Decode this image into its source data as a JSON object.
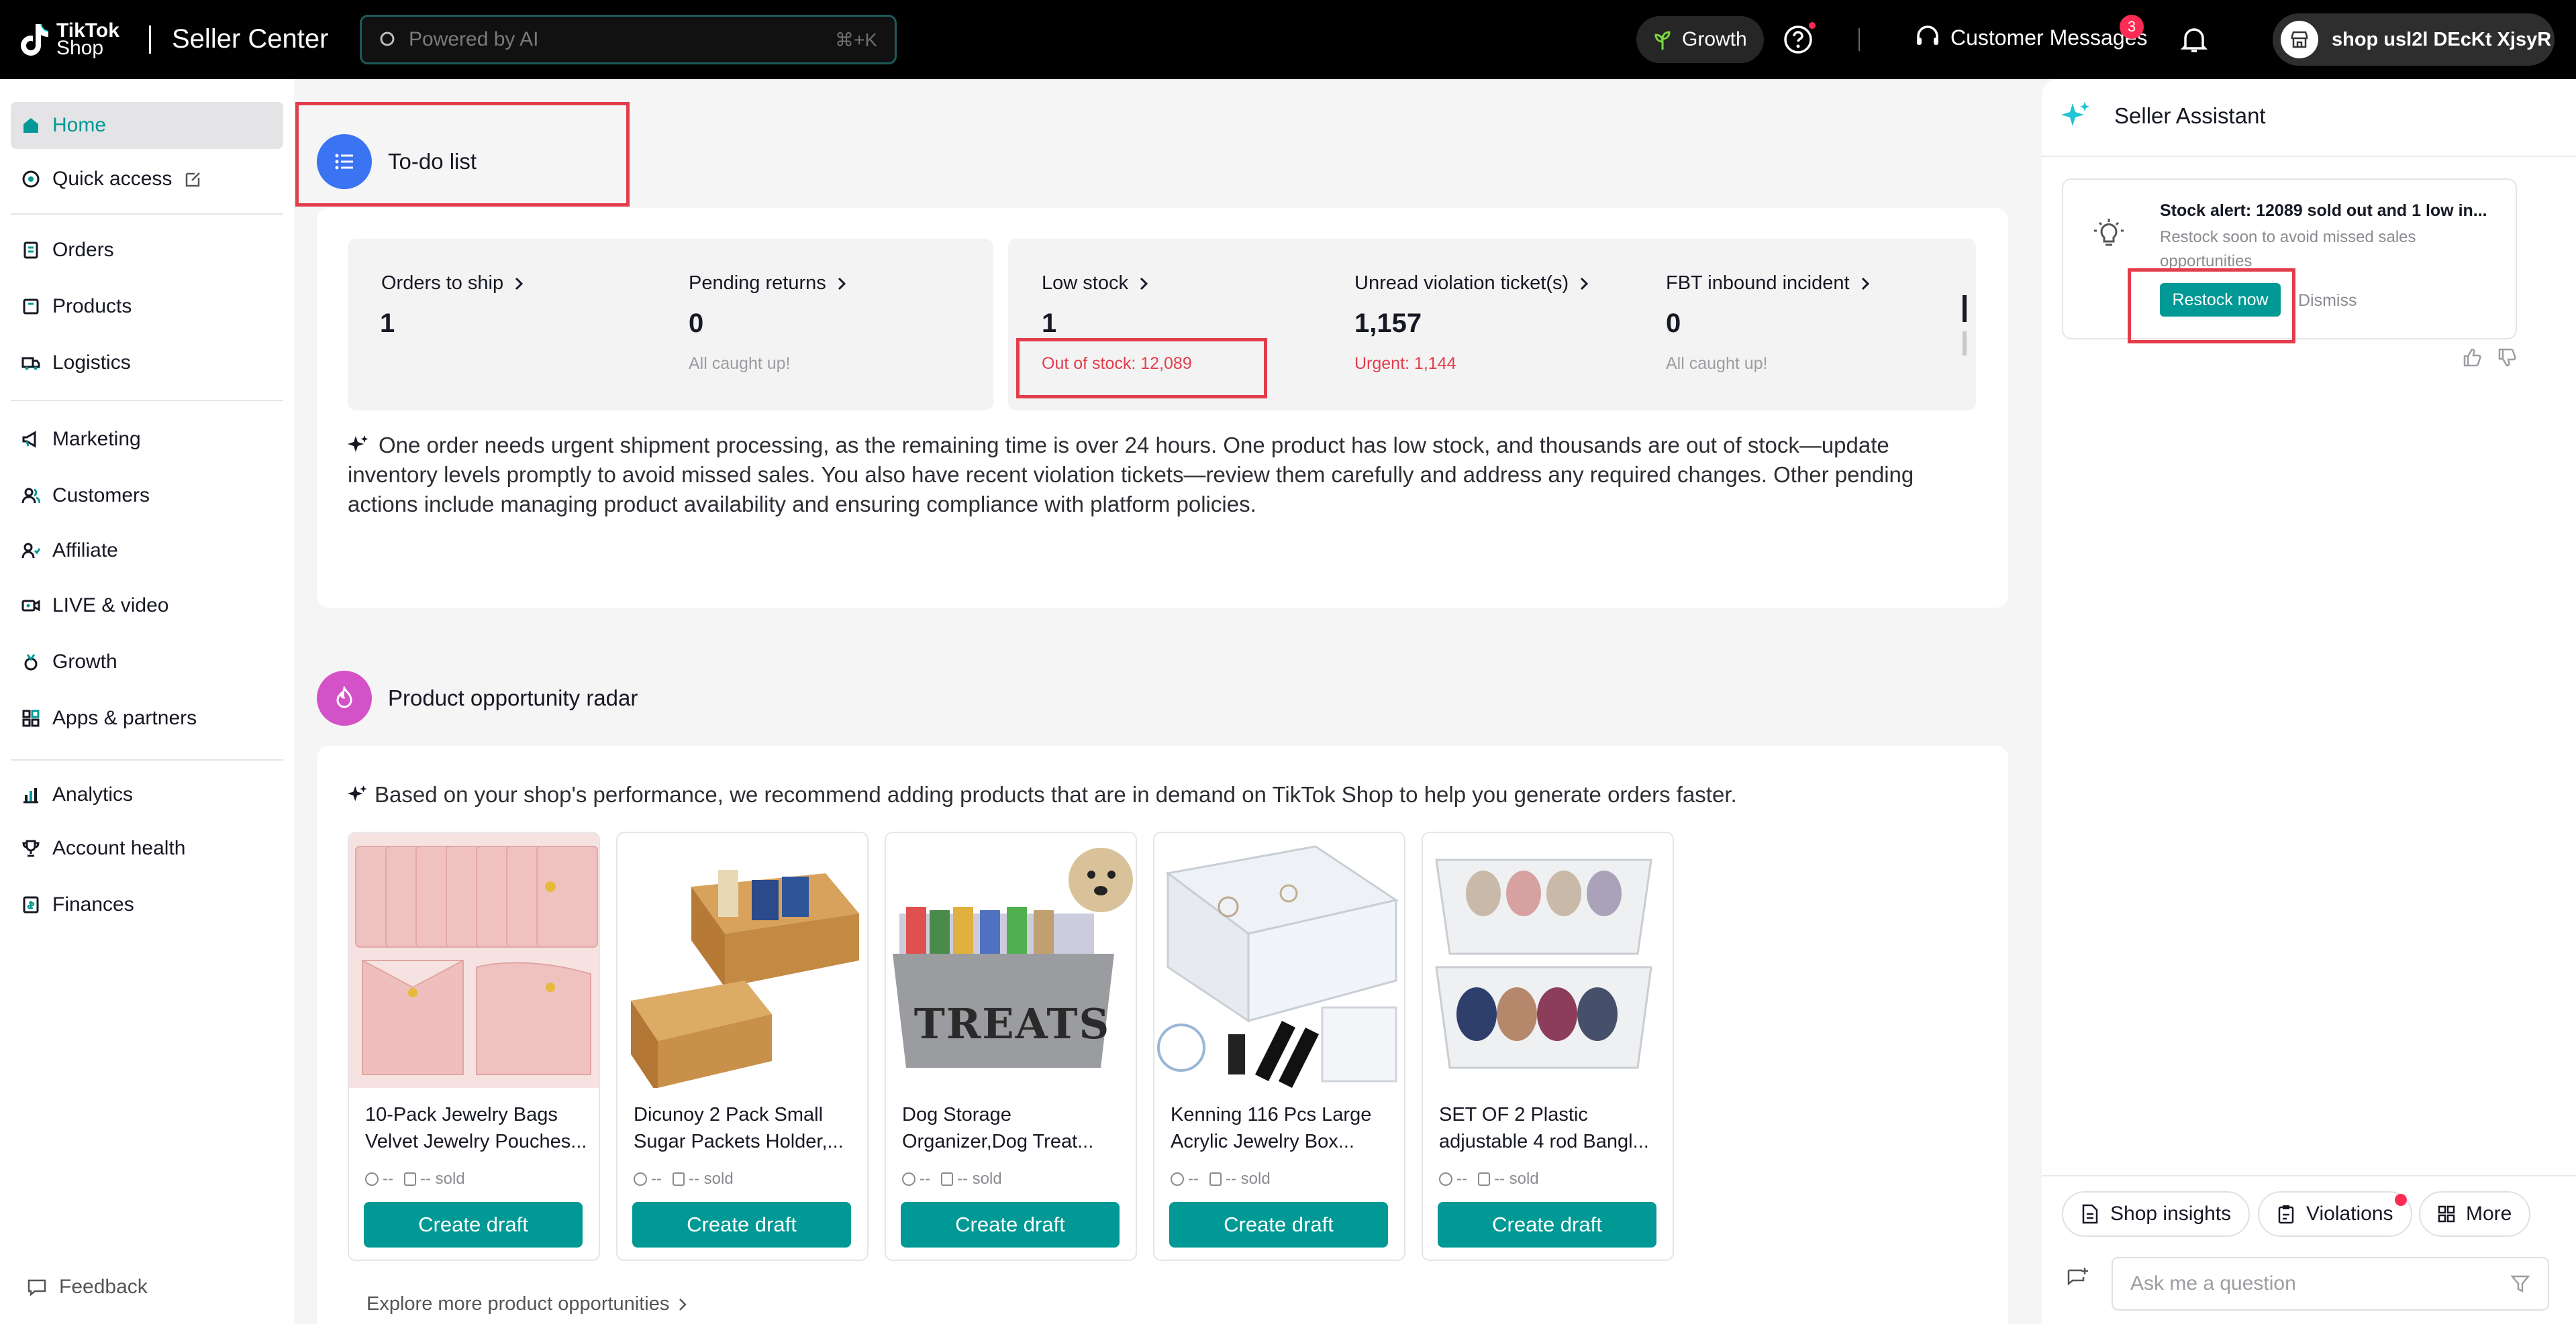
{
  "topbar": {
    "logo_line1": "TikTok",
    "logo_line2": "Shop",
    "app_title": "Seller Center",
    "search_placeholder": "Powered by AI",
    "search_shortcut": "⌘+K",
    "growth_label": "Growth",
    "customer_messages_label": "Customer Messages",
    "customer_messages_count": "3",
    "shop_name": "shop usl2l DEcKt XjsyR"
  },
  "sidebar": {
    "items": [
      {
        "label": "Home",
        "icon": "home-icon"
      },
      {
        "label": "Quick access",
        "icon": "quick-access-icon"
      },
      {
        "label": "Orders",
        "icon": "orders-icon"
      },
      {
        "label": "Products",
        "icon": "products-icon"
      },
      {
        "label": "Logistics",
        "icon": "logistics-icon"
      },
      {
        "label": "Marketing",
        "icon": "megaphone-icon"
      },
      {
        "label": "Customers",
        "icon": "customers-icon"
      },
      {
        "label": "Affiliate",
        "icon": "affiliate-icon"
      },
      {
        "label": "LIVE & video",
        "icon": "video-icon"
      },
      {
        "label": "Growth",
        "icon": "medal-icon"
      },
      {
        "label": "Apps & partners",
        "icon": "apps-icon"
      },
      {
        "label": "Analytics",
        "icon": "analytics-icon"
      },
      {
        "label": "Account health",
        "icon": "trophy-icon"
      },
      {
        "label": "Finances",
        "icon": "finances-icon"
      }
    ],
    "feedback_label": "Feedback"
  },
  "todo": {
    "title": "To-do list",
    "stats": [
      {
        "label": "Orders to ship",
        "value": "1",
        "sub": ""
      },
      {
        "label": "Pending returns",
        "value": "0",
        "sub": "All caught up!"
      },
      {
        "label": "Low stock",
        "value": "1",
        "sub": "Out of stock: 12,089"
      },
      {
        "label": "Unread violation ticket(s)",
        "value": "1,157",
        "sub": "Urgent: 1,144"
      },
      {
        "label": "FBT inbound incident",
        "value": "0",
        "sub": "All caught up!"
      }
    ],
    "summary": "One order needs urgent shipment processing, as the remaining time is over 24 hours. One product has low stock, and thousands are out of stock—update inventory levels promptly to avoid missed sales. You also have recent violation tickets—review them carefully and address any required changes. Other pending actions include managing product availability and ensuring compliance with platform policies."
  },
  "radar": {
    "title": "Product opportunity radar",
    "subtitle": "Based on your shop's performance, we recommend adding products that are in demand on TikTok Shop to help you generate orders faster.",
    "products": [
      {
        "name": "10-Pack Jewelry Bags Velvet Jewelry Pouches...",
        "price": "--",
        "sold": "-- sold",
        "button": "Create draft"
      },
      {
        "name": "Dicunoy 2 Pack Small Sugar Packets Holder,...",
        "price": "--",
        "sold": "-- sold",
        "button": "Create draft"
      },
      {
        "name": "Dog Storage Organizer,Dog Treat...",
        "price": "--",
        "sold": "-- sold",
        "button": "Create draft",
        "image_text": "TREATS"
      },
      {
        "name": "Kenning 116 Pcs Large Acrylic Jewelry Box...",
        "price": "--",
        "sold": "-- sold",
        "button": "Create draft"
      },
      {
        "name": "SET OF 2 Plastic adjustable 4 rod Bangl...",
        "price": "--",
        "sold": "-- sold",
        "button": "Create draft"
      }
    ],
    "explore_label": "Explore more product opportunities"
  },
  "assistant": {
    "title": "Seller Assistant",
    "alert_title": "Stock alert: 12089 sold out and 1 low in...",
    "alert_desc": "Restock soon to avoid missed sales opportunities",
    "restock_label": "Restock now",
    "dismiss_label": "Dismiss",
    "chips": [
      {
        "label": "Shop insights",
        "icon": "document-icon"
      },
      {
        "label": "Violations",
        "icon": "clipboard-icon"
      },
      {
        "label": "More",
        "icon": "grid-icon"
      }
    ],
    "ask_placeholder": "Ask me a question"
  },
  "colors": {
    "accent": "#009995",
    "highlight_red": "#e33d4b",
    "badge": "#fe2c55",
    "todo_icon_bg": "#3b74f2",
    "radar_icon_bg": "#d452c8"
  }
}
